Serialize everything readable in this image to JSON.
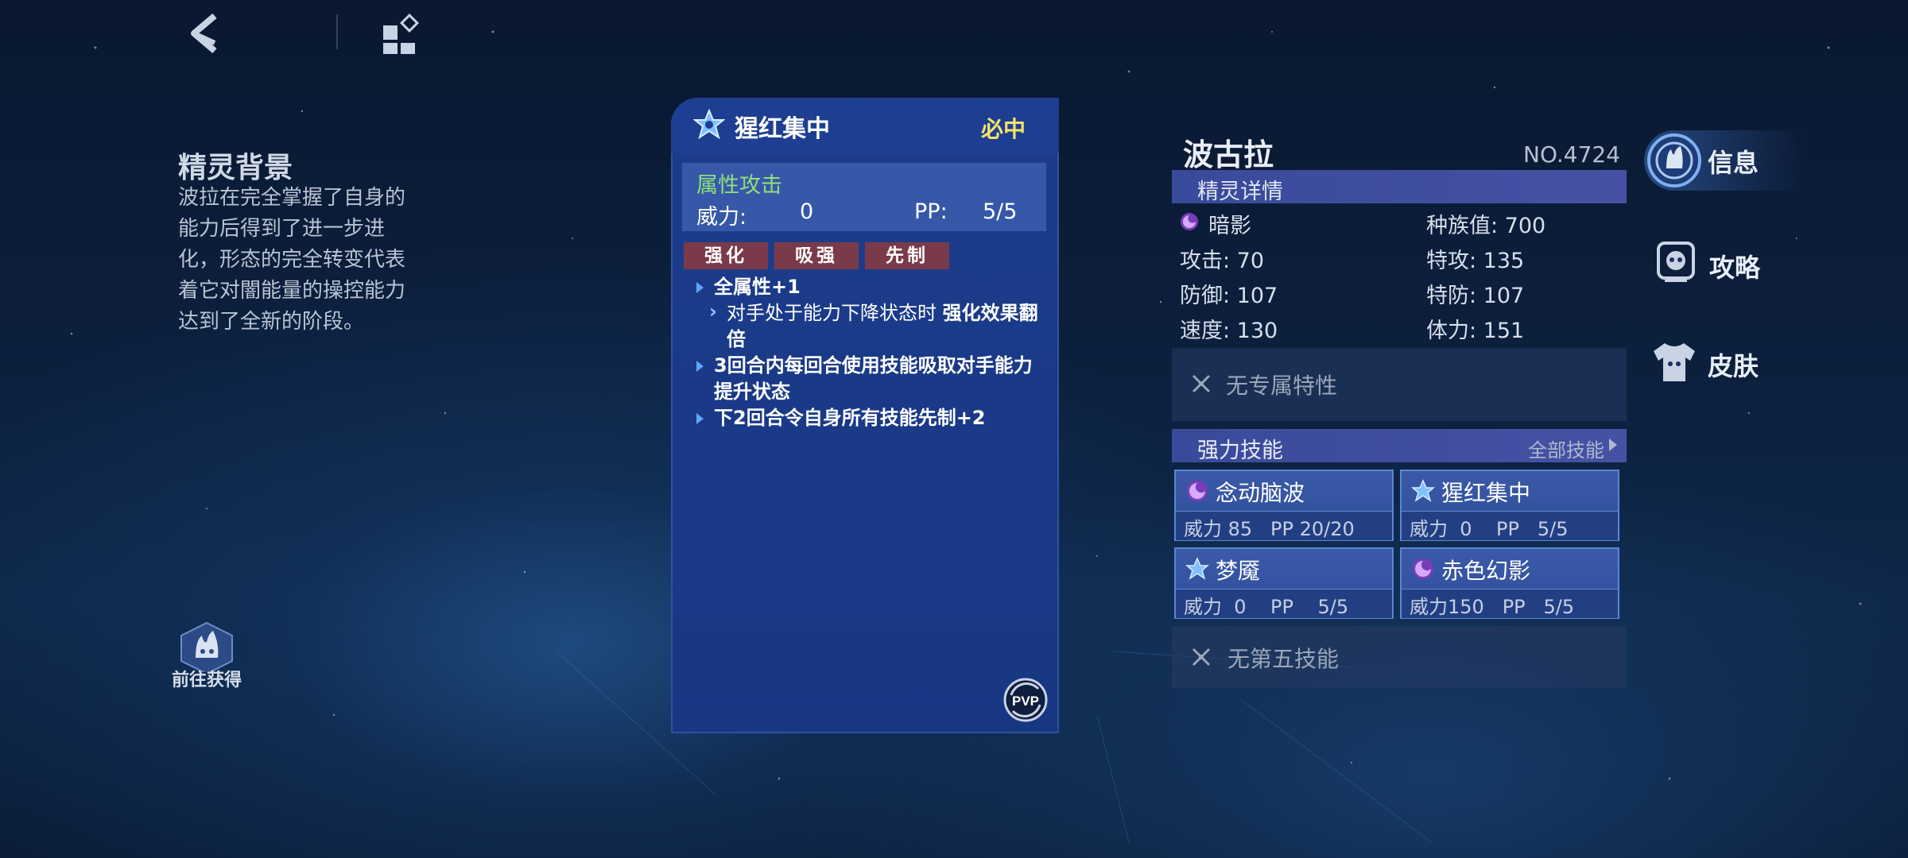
{
  "nav": {
    "back_icon": "back-chevron-icon",
    "menu_icon": "grid-menu-icon"
  },
  "background": {
    "title": "精灵背景",
    "text": "波拉在完全掌握了自身的能力后得到了进一步进化，形态的完全转变代表着它对闇能量的操控能力达到了全新的阶段。"
  },
  "goto": {
    "label": "前往获得"
  },
  "skill_card": {
    "title": "猩红集中",
    "badge": "必中",
    "attack_type": "属性攻击",
    "power_label": "威力:",
    "power_value": "0",
    "pp_label": "PP:",
    "pp_value": "5/5",
    "tags": [
      "强化",
      "吸强",
      "先制"
    ],
    "effects": {
      "e1": "全属性+1",
      "e1_sub_a": "对手处于能力下降状态时 ",
      "e1_sub_b": "强化效果翻倍",
      "e2": "3回合内每回合使用技能吸取对手能力提升状态",
      "e3": "下2回合令自身所有技能先制+2"
    },
    "pvp_label": "PVP"
  },
  "pet": {
    "name": "波古拉",
    "number": "NO.4724",
    "detail_label": "精灵详情",
    "type": "暗影",
    "stats": {
      "total": "种族值: 700",
      "atk": "攻击: 70",
      "spatk": "特攻: 135",
      "def": "防御: 107",
      "spdef": "特防: 107",
      "speed": "速度: 130",
      "hp": "体力: 151"
    },
    "trait": "无专属特性",
    "skills_label": "强力技能",
    "all_skills": "全部技能",
    "skills": [
      {
        "name": "念动脑波",
        "stat": "威力 85   PP 20/20"
      },
      {
        "name": "猩红集中",
        "stat": "威力  0    PP   5/5"
      },
      {
        "name": "梦魇",
        "stat": "威力  0    PP    5/5"
      },
      {
        "name": "赤色幻影",
        "stat": "威力150   PP   5/5"
      }
    ],
    "fifth_skill": "无第五技能"
  },
  "side_menu": {
    "info": "信息",
    "guide": "攻略",
    "skin": "皮肤"
  },
  "colors": {
    "accent_yellow": "#f7e26a",
    "attack_green": "#8fe07a",
    "tag_red": "#7a3a4a",
    "card_blue": "#1c3d8c"
  }
}
